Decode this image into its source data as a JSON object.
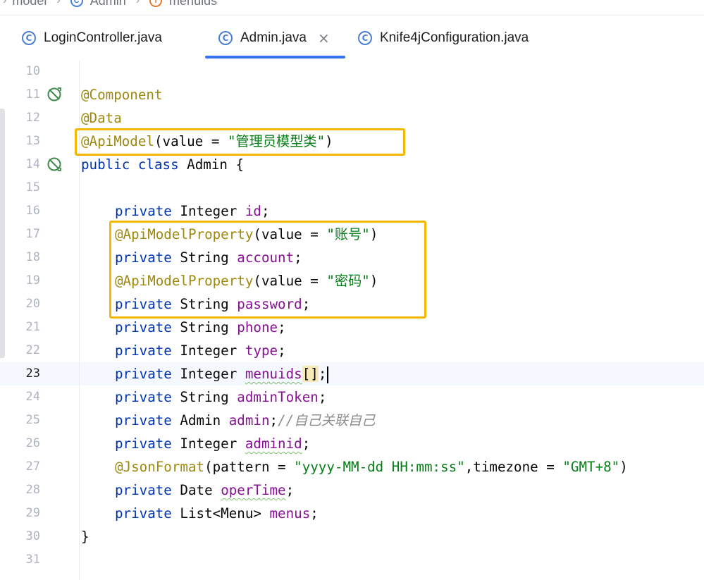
{
  "breadcrumb": {
    "items": [
      {
        "label": "model",
        "icon": "folder-icon"
      },
      {
        "label": "Admin",
        "icon": "class-icon"
      },
      {
        "label": "menuids",
        "icon": "field-icon"
      }
    ]
  },
  "tabs": [
    {
      "label": "LoginController.java",
      "icon": "class-icon",
      "active": false
    },
    {
      "label": "Admin.java",
      "icon": "class-icon",
      "active": true,
      "close": "×"
    },
    {
      "label": "Knife4jConfiguration.java",
      "icon": "class-icon",
      "active": false
    }
  ],
  "editor": {
    "current_line": 23,
    "line_numbers": [
      "10",
      "11",
      "12",
      "13",
      "14",
      "15",
      "16",
      "17",
      "18",
      "19",
      "20",
      "21",
      "22",
      "23",
      "24",
      "25",
      "26",
      "27",
      "28",
      "29",
      "30",
      "31"
    ],
    "lines": {
      "l11": {
        "ann": "@Component"
      },
      "l12": {
        "ann": "@Data"
      },
      "l13": {
        "ann": "@ApiModel",
        "open": "(value = ",
        "str": "\"管理员模型类\"",
        "close": ")"
      },
      "l14": {
        "kw": "public class",
        "rest": " Admin {"
      },
      "l16": {
        "kw": "private",
        "type": " Integer ",
        "field": "id",
        "end": ";"
      },
      "l17": {
        "ann": "@ApiModelProperty",
        "open": "(value = ",
        "str": "\"账号\"",
        "close": ")"
      },
      "l18": {
        "kw": "private",
        "type": " String ",
        "field": "account",
        "end": ";"
      },
      "l19": {
        "ann": "@ApiModelProperty",
        "open": "(value = ",
        "str": "\"密码\"",
        "close": ")"
      },
      "l20": {
        "kw": "private",
        "type": " String ",
        "field": "password",
        "end": ";"
      },
      "l21": {
        "kw": "private",
        "type": " String ",
        "field": "phone",
        "end": ";"
      },
      "l22": {
        "kw": "private",
        "type": " Integer ",
        "field": "type",
        "end": ";"
      },
      "l23": {
        "kw": "private",
        "type": " Integer ",
        "field": "menuids",
        "brackets": "[]",
        "end": ";"
      },
      "l24": {
        "kw": "private",
        "type": " String ",
        "field": "adminToken",
        "end": ";"
      },
      "l25": {
        "kw": "private",
        "type": " Admin ",
        "field": "admin",
        "end": ";",
        "comment": "//自己关联自己"
      },
      "l26": {
        "kw": "private",
        "type": " Integer ",
        "field": "adminid",
        "end": ";"
      },
      "l27": {
        "ann": "@JsonFormat",
        "open": "(pattern = ",
        "str": "\"yyyy-MM-dd HH:mm:ss\"",
        "mid": ",timezone = ",
        "str2": "\"GMT+8\"",
        "close": ")"
      },
      "l28": {
        "kw": "private",
        "type": " Date ",
        "field": "operTime",
        "end": ";"
      },
      "l29": {
        "kw": "private",
        "type": " List<Menu> ",
        "field": "menus",
        "end": ";"
      },
      "l30": {
        "rest": "}"
      }
    }
  },
  "colors": {
    "keyword": "#0033b3",
    "annotation": "#9e880d",
    "field": "#871094",
    "string": "#067d17",
    "comment": "#8c8c8c",
    "highlight_box": "#f5b800",
    "tab_accent": "#3574f0"
  }
}
